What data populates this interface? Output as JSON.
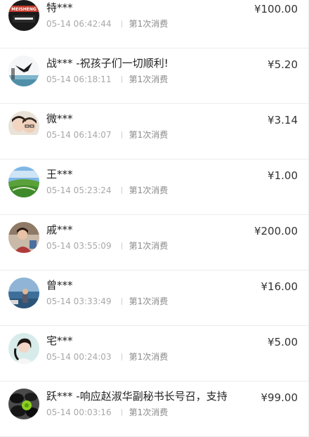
{
  "records": [
    {
      "name": "特***",
      "message": "",
      "time": "05-14 06:42:44",
      "count": "第1次消费",
      "amount": "¥100.00",
      "avatar": "brand-logo-avatar"
    },
    {
      "name": "战***",
      "message": "-祝孩子们一切顺利!",
      "time": "05-14 06:18:11",
      "count": "第1次消费",
      "amount": "¥5.20",
      "avatar": "eagle-ink-avatar"
    },
    {
      "name": "微***",
      "message": "",
      "time": "05-14 06:14:07",
      "count": "第1次消费",
      "amount": "¥3.14",
      "avatar": "couple-photo-avatar"
    },
    {
      "name": "王***",
      "message": "",
      "time": "05-14 05:23:24",
      "count": "第1次消费",
      "amount": "¥1.00",
      "avatar": "grassland-avatar"
    },
    {
      "name": "戚***",
      "message": "",
      "time": "05-14 03:55:09",
      "count": "第1次消费",
      "amount": "¥200.00",
      "avatar": "woman-portrait-avatar"
    },
    {
      "name": "曾***",
      "message": "",
      "time": "05-14 03:33:49",
      "count": "第1次消费",
      "amount": "¥16.00",
      "avatar": "seaside-person-avatar"
    },
    {
      "name": "宅***",
      "message": "",
      "time": "05-14 00:24:03",
      "count": "第1次消费",
      "amount": "¥5.00",
      "avatar": "girl-portrait-avatar"
    },
    {
      "name": "跃***",
      "message": "-响应赵淑华副秘书长号召，支持",
      "time": "05-14 00:03:16",
      "count": "第1次消费",
      "amount": "¥99.00",
      "avatar": "stones-flower-avatar"
    }
  ],
  "colors": {
    "name_text": "#222222",
    "meta_text": "#a8a8a8",
    "amount_text": "#333333",
    "divider": "#ececec"
  }
}
